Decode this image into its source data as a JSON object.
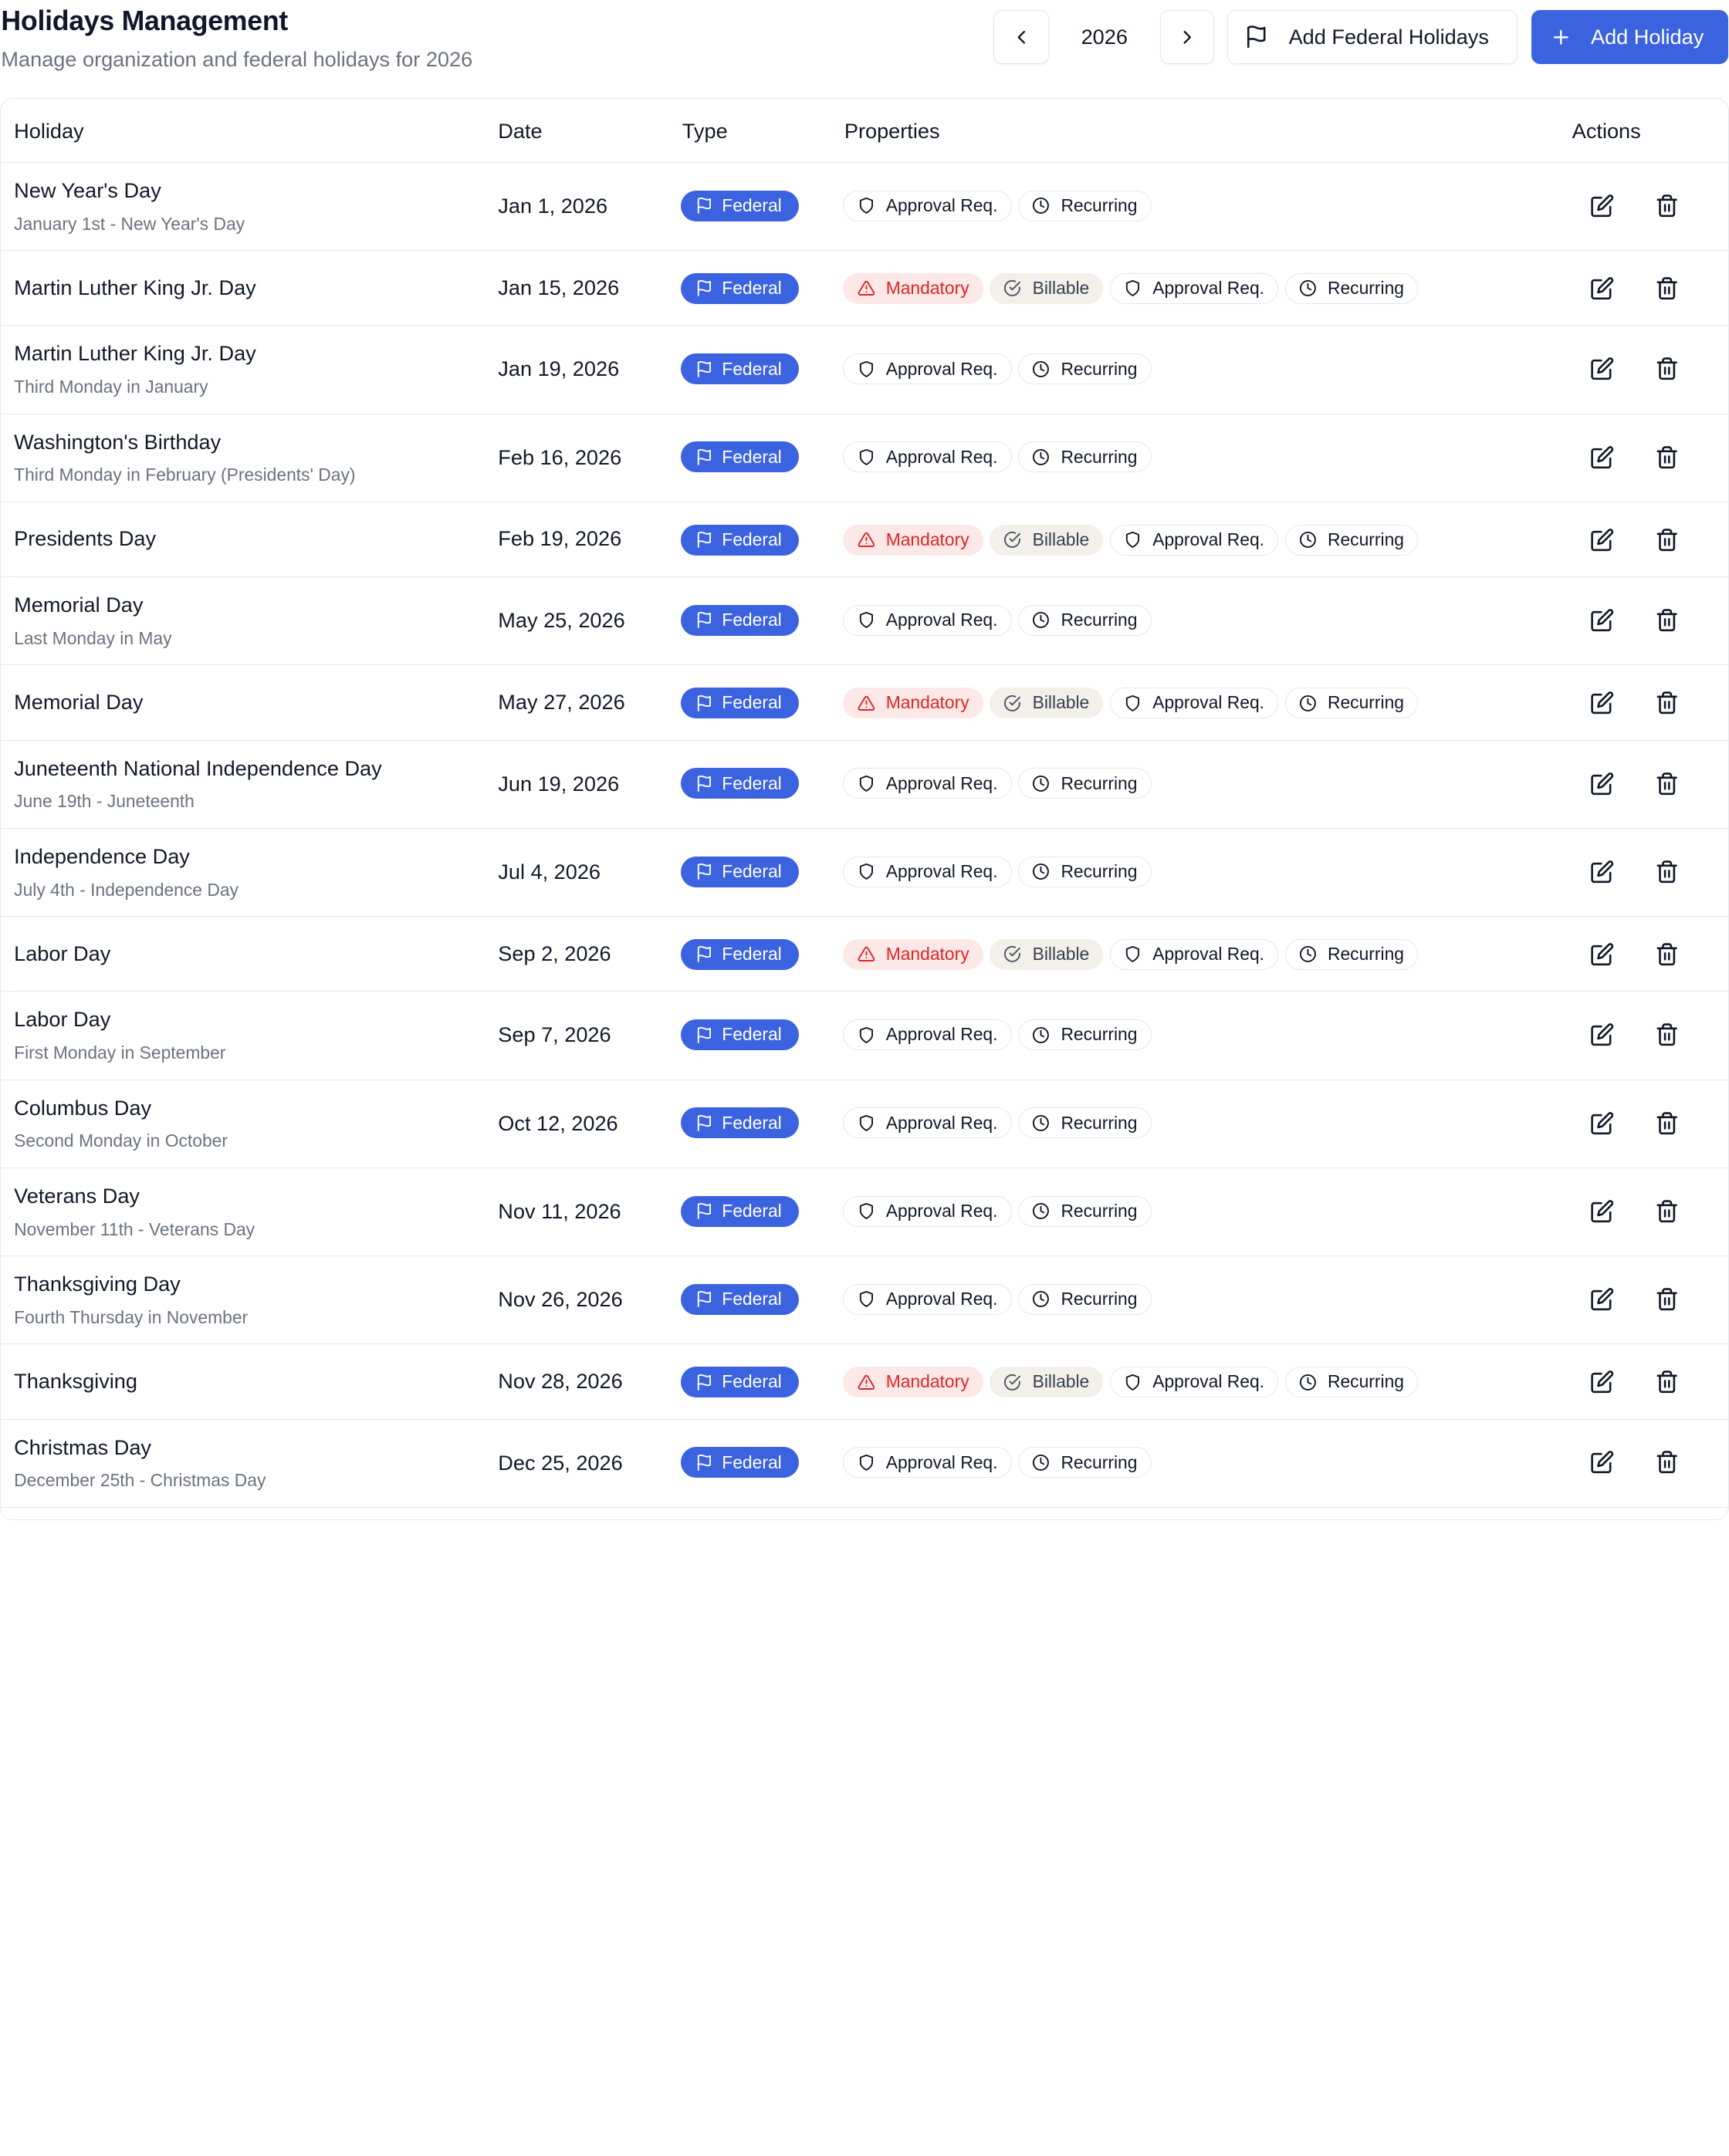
{
  "header": {
    "title": "Holidays Management",
    "subtitle": "Manage organization and federal holidays for 2026",
    "year": "2026",
    "add_federal_label": "Add Federal Holidays",
    "add_holiday_label": "Add Holiday"
  },
  "colors": {
    "primary": "#3b63e0",
    "mandatory_text": "#dc2626",
    "mandatory_bg": "#fde8e8",
    "billable_bg": "#f3f0ea",
    "muted_text": "#6b7280",
    "border": "#e5e7eb"
  },
  "icons": {
    "prev": "chevron-left-icon",
    "next": "chevron-right-icon",
    "flag": "flag-icon",
    "plus": "plus-icon",
    "mandatory": "alert-triangle-icon",
    "billable": "check-circle-icon",
    "approval": "shield-icon",
    "recurring": "clock-icon",
    "edit": "edit-icon",
    "delete": "trash-icon"
  },
  "table": {
    "headers": {
      "holiday": "Holiday",
      "date": "Date",
      "type": "Type",
      "properties": "Properties",
      "actions": "Actions"
    },
    "property_labels": {
      "mandatory": "Mandatory",
      "billable": "Billable",
      "approval": "Approval Req.",
      "recurring": "Recurring"
    },
    "rows": [
      {
        "name": "New Year's Day",
        "description": "January 1st - New Year's Day",
        "date": "Jan 1, 2026",
        "type": "Federal",
        "mandatory": false,
        "billable": false
      },
      {
        "name": "Martin Luther King Jr. Day",
        "description": "",
        "date": "Jan 15, 2026",
        "type": "Federal",
        "mandatory": true,
        "billable": true
      },
      {
        "name": "Martin Luther King Jr. Day",
        "description": "Third Monday in January",
        "date": "Jan 19, 2026",
        "type": "Federal",
        "mandatory": false,
        "billable": false
      },
      {
        "name": "Washington's Birthday",
        "description": "Third Monday in February (Presidents' Day)",
        "date": "Feb 16, 2026",
        "type": "Federal",
        "mandatory": false,
        "billable": false
      },
      {
        "name": "Presidents Day",
        "description": "",
        "date": "Feb 19, 2026",
        "type": "Federal",
        "mandatory": true,
        "billable": true
      },
      {
        "name": "Memorial Day",
        "description": "Last Monday in May",
        "date": "May 25, 2026",
        "type": "Federal",
        "mandatory": false,
        "billable": false
      },
      {
        "name": "Memorial Day",
        "description": "",
        "date": "May 27, 2026",
        "type": "Federal",
        "mandatory": true,
        "billable": true
      },
      {
        "name": "Juneteenth National Independence Day",
        "description": "June 19th - Juneteenth",
        "date": "Jun 19, 2026",
        "type": "Federal",
        "mandatory": false,
        "billable": false
      },
      {
        "name": "Independence Day",
        "description": "July 4th - Independence Day",
        "date": "Jul 4, 2026",
        "type": "Federal",
        "mandatory": false,
        "billable": false
      },
      {
        "name": "Labor Day",
        "description": "",
        "date": "Sep 2, 2026",
        "type": "Federal",
        "mandatory": true,
        "billable": true
      },
      {
        "name": "Labor Day",
        "description": "First Monday in September",
        "date": "Sep 7, 2026",
        "type": "Federal",
        "mandatory": false,
        "billable": false
      },
      {
        "name": "Columbus Day",
        "description": "Second Monday in October",
        "date": "Oct 12, 2026",
        "type": "Federal",
        "mandatory": false,
        "billable": false
      },
      {
        "name": "Veterans Day",
        "description": "November 11th - Veterans Day",
        "date": "Nov 11, 2026",
        "type": "Federal",
        "mandatory": false,
        "billable": false
      },
      {
        "name": "Thanksgiving Day",
        "description": "Fourth Thursday in November",
        "date": "Nov 26, 2026",
        "type": "Federal",
        "mandatory": false,
        "billable": false
      },
      {
        "name": "Thanksgiving",
        "description": "",
        "date": "Nov 28, 2026",
        "type": "Federal",
        "mandatory": true,
        "billable": true
      },
      {
        "name": "Christmas Day",
        "description": "December 25th - Christmas Day",
        "date": "Dec 25, 2026",
        "type": "Federal",
        "mandatory": false,
        "billable": false
      }
    ]
  }
}
